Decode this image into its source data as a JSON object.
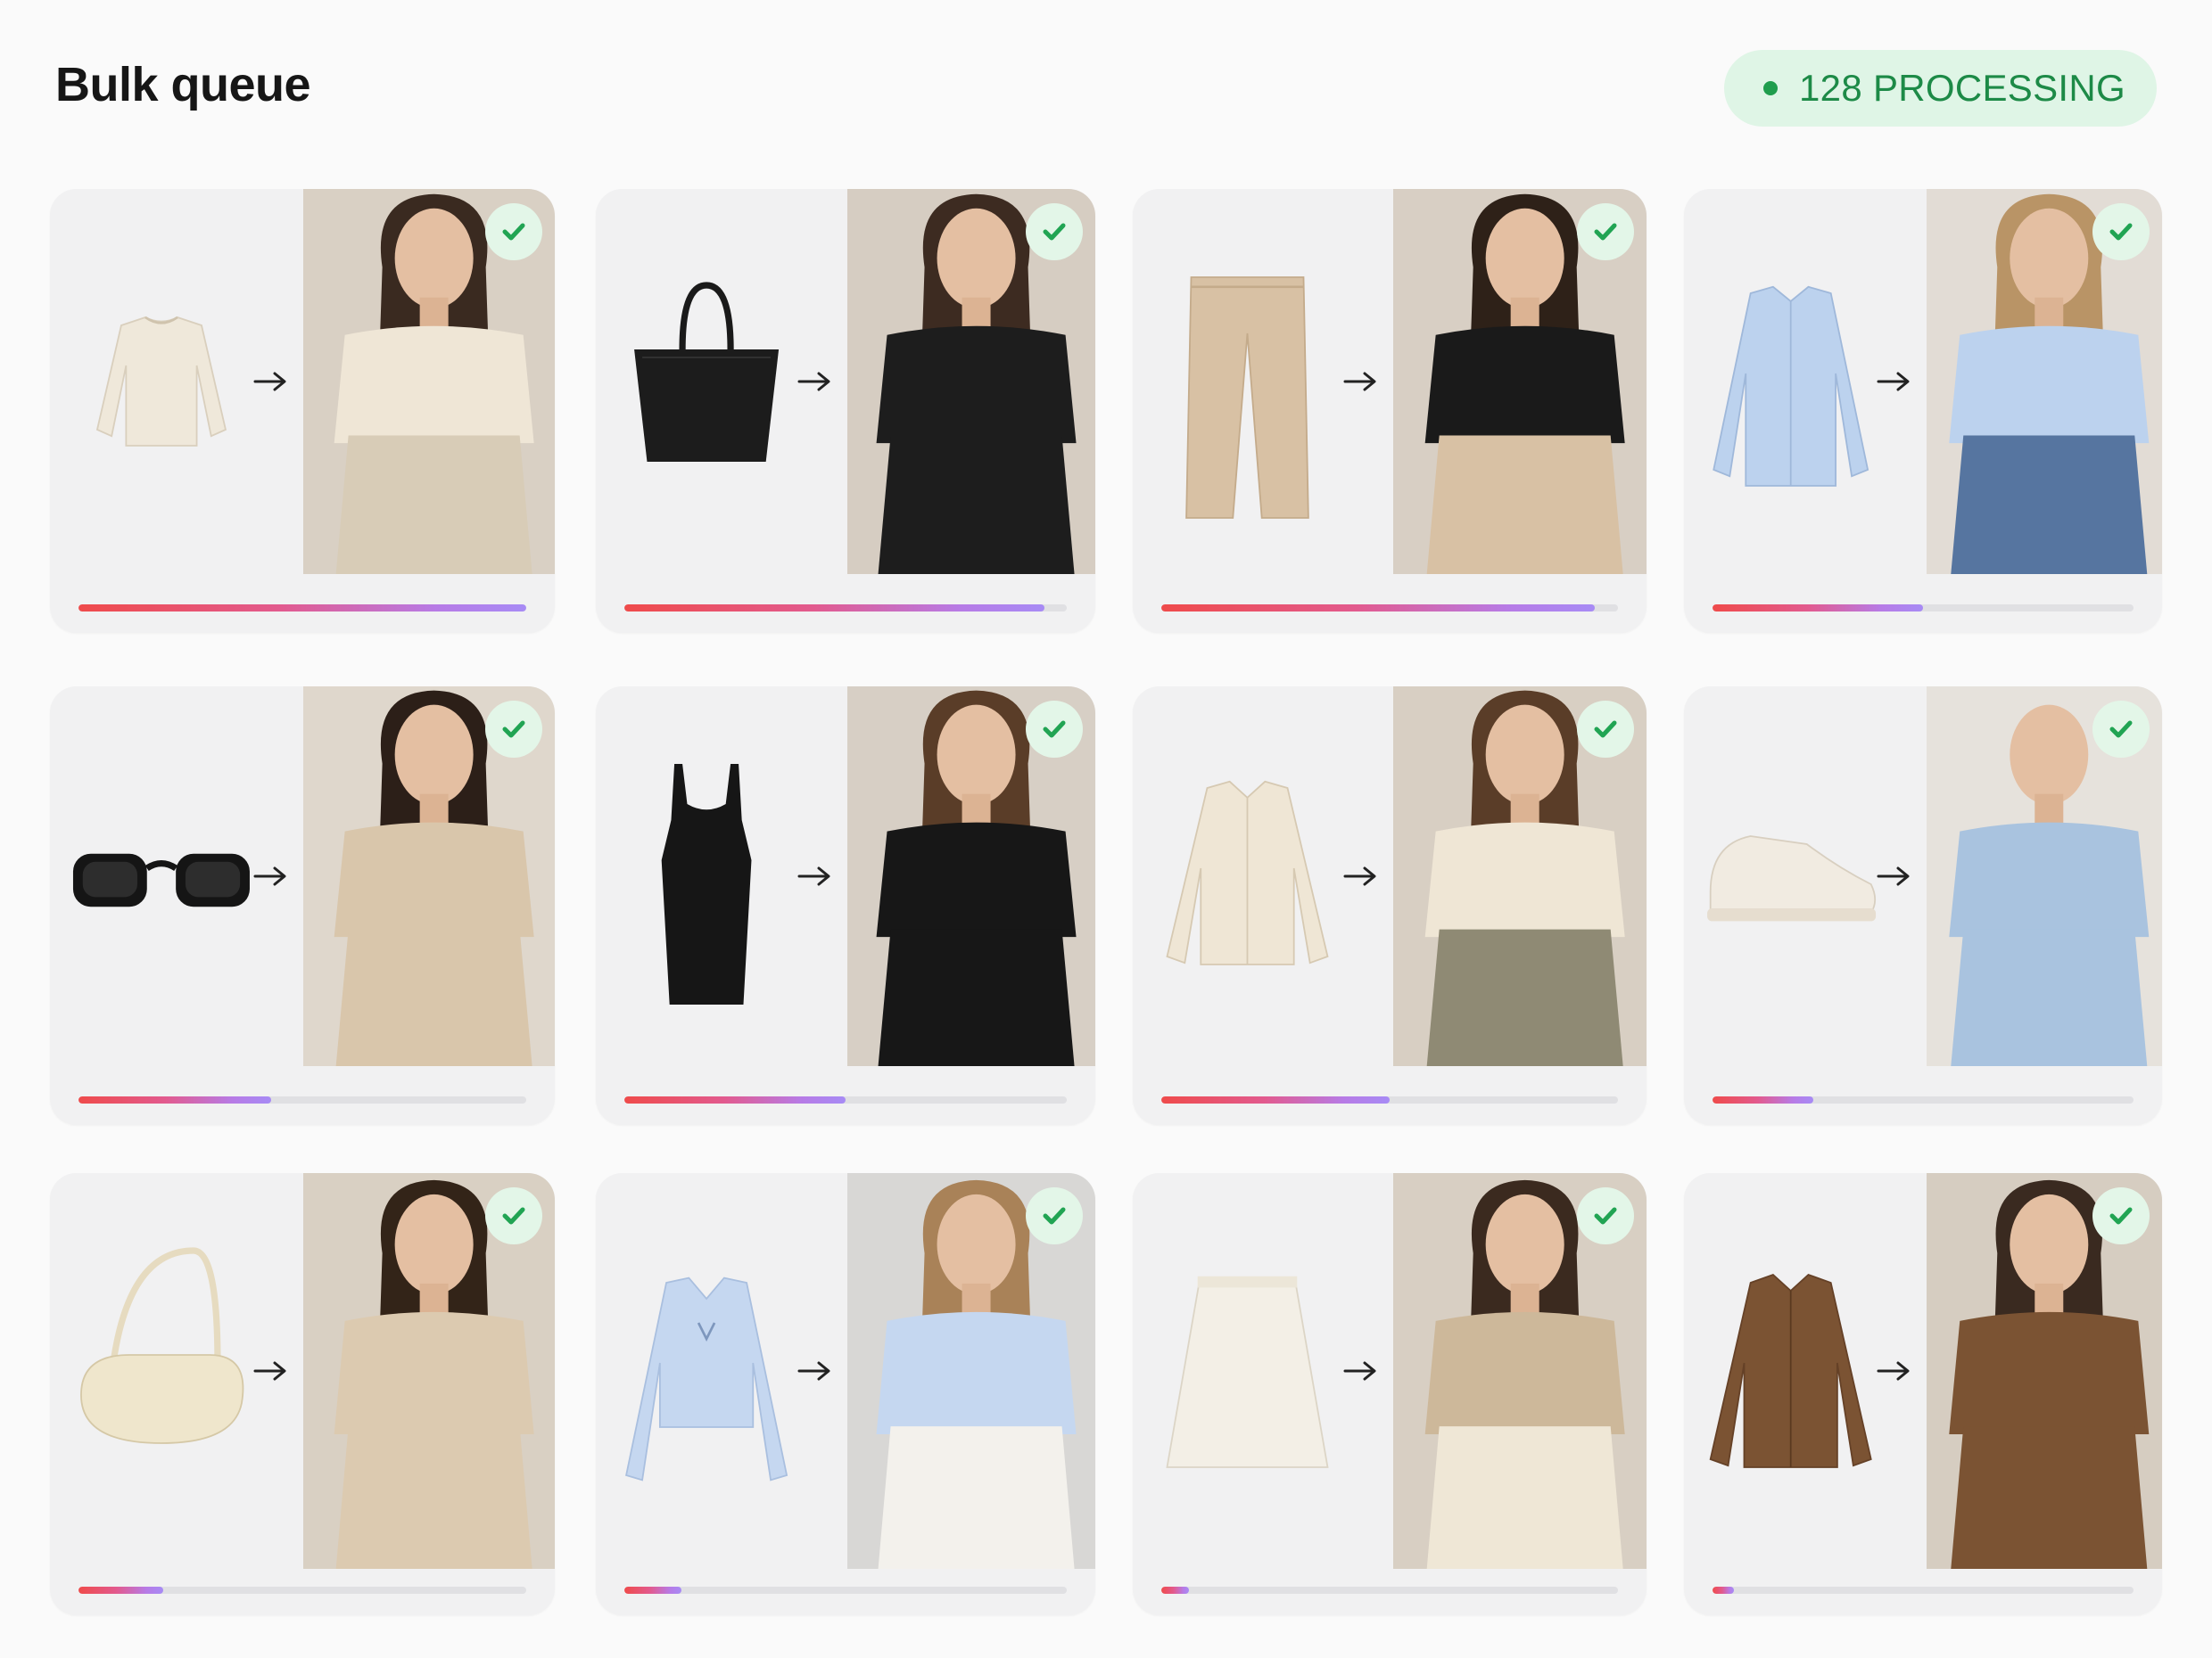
{
  "header": {
    "title": "Bulk queue",
    "status": "128 PROCESSING",
    "status_color": "#1d8a47",
    "status_bg": "#dff5e6"
  },
  "accent_gradient": [
    "#ef4b4b",
    "#e25a8e",
    "#b77be6",
    "#a78bf5"
  ],
  "queue": [
    {
      "item": "cream sweater",
      "status": "done",
      "progress": 1.0
    },
    {
      "item": "black tote bag",
      "status": "done",
      "progress": 0.95
    },
    {
      "item": "beige trousers",
      "status": "done",
      "progress": 0.95
    },
    {
      "item": "blue shirt",
      "status": "done",
      "progress": 0.5
    },
    {
      "item": "black sunglasses",
      "status": "done",
      "progress": 0.43
    },
    {
      "item": "black dress",
      "status": "done",
      "progress": 0.5
    },
    {
      "item": "cream jacket",
      "status": "done",
      "progress": 0.5
    },
    {
      "item": "white sneakers",
      "status": "done",
      "progress": 0.24
    },
    {
      "item": "cream shoulder bag",
      "status": "done",
      "progress": 0.19
    },
    {
      "item": "blue blouse",
      "status": "done",
      "progress": 0.13
    },
    {
      "item": "white skirt",
      "status": "done",
      "progress": 0.06
    },
    {
      "item": "brown jacket",
      "status": "done",
      "progress": 0.05
    }
  ]
}
